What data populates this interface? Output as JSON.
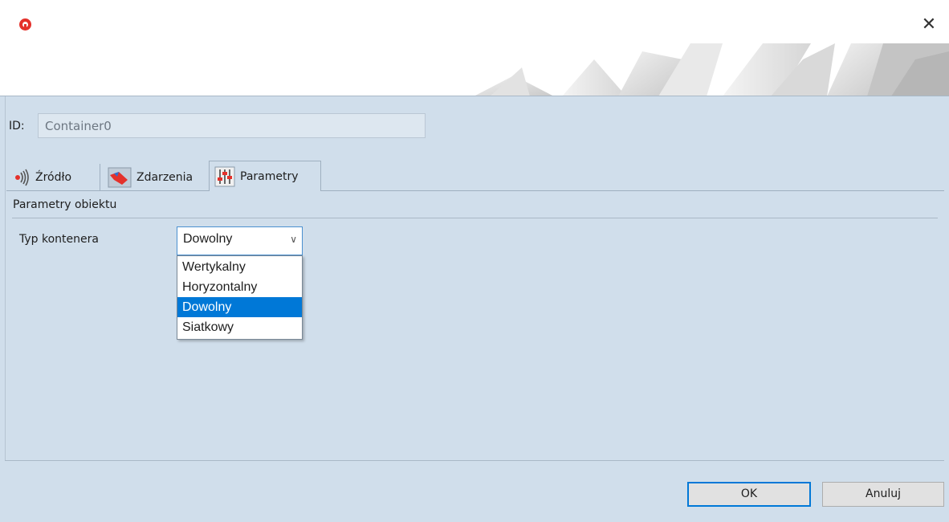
{
  "window": {
    "app_icon": "home-icon",
    "close_label": "✕"
  },
  "id_field": {
    "label": "ID:",
    "value": "Container0"
  },
  "tabs": [
    {
      "label": "Źródło",
      "icon": "source-signal-icon",
      "active": false
    },
    {
      "label": "Zdarzenia",
      "icon": "events-icon",
      "active": false
    },
    {
      "label": "Parametry",
      "icon": "parameters-sliders-icon",
      "active": true
    }
  ],
  "section": {
    "title": "Parametry obiektu"
  },
  "container_type": {
    "label": "Typ kontenera",
    "selected": "Dowolny",
    "options": [
      "Wertykalny",
      "Horyzontalny",
      "Dowolny",
      "Siatkowy"
    ],
    "highlighted_index": 2
  },
  "buttons": {
    "ok": "OK",
    "cancel": "Anuluj"
  },
  "colors": {
    "accent": "#0078d7",
    "brand": "#e4312b",
    "panel": "#d0deeb"
  }
}
